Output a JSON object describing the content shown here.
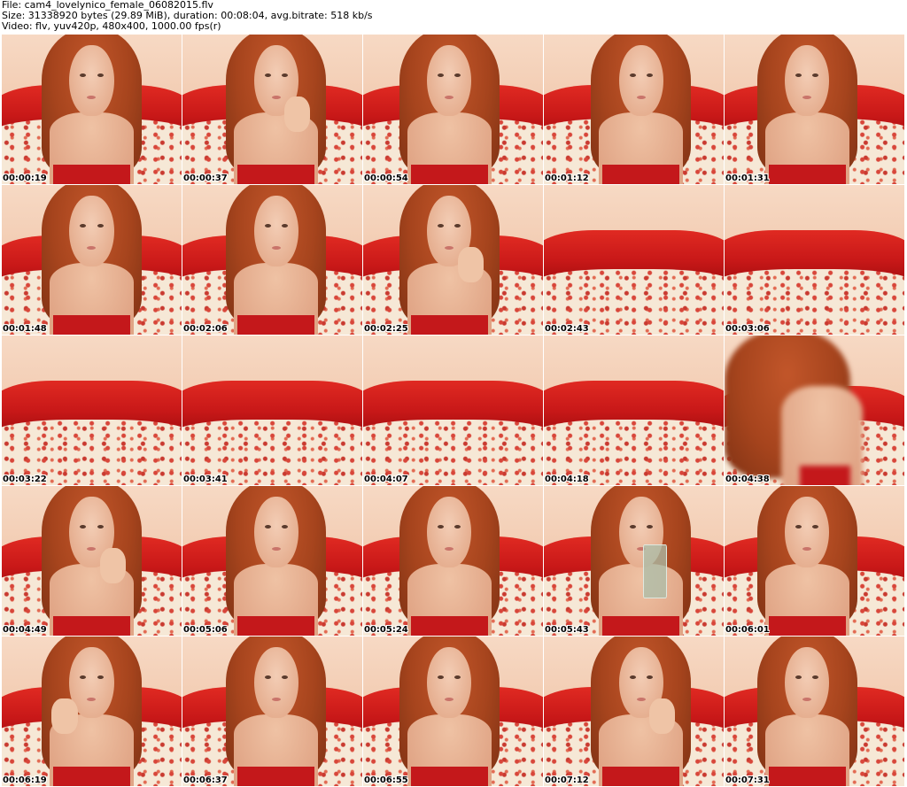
{
  "header": {
    "file_line": "File: cam4_lovelynico_female_06082015.flv",
    "size_line": "Size: 31338920 bytes (29.89 MiB), duration: 00:08:04, avg.bitrate: 518 kb/s",
    "video_line": "Video: flv, yuv420p, 480x400, 1000.00 fps(r)"
  },
  "frames": [
    {
      "timestamp": "00:00:19",
      "scene": "person"
    },
    {
      "timestamp": "00:00:37",
      "scene": "person-hand"
    },
    {
      "timestamp": "00:00:54",
      "scene": "person"
    },
    {
      "timestamp": "00:01:12",
      "scene": "person"
    },
    {
      "timestamp": "00:01:31",
      "scene": "person"
    },
    {
      "timestamp": "00:01:48",
      "scene": "person"
    },
    {
      "timestamp": "00:02:06",
      "scene": "person"
    },
    {
      "timestamp": "00:02:25",
      "scene": "person-hand"
    },
    {
      "timestamp": "00:02:43",
      "scene": "empty"
    },
    {
      "timestamp": "00:03:06",
      "scene": "empty"
    },
    {
      "timestamp": "00:03:22",
      "scene": "empty"
    },
    {
      "timestamp": "00:03:41",
      "scene": "empty"
    },
    {
      "timestamp": "00:04:07",
      "scene": "empty"
    },
    {
      "timestamp": "00:04:18",
      "scene": "empty"
    },
    {
      "timestamp": "00:04:38",
      "scene": "blur"
    },
    {
      "timestamp": "00:04:49",
      "scene": "person-hand"
    },
    {
      "timestamp": "00:05:06",
      "scene": "person"
    },
    {
      "timestamp": "00:05:24",
      "scene": "person"
    },
    {
      "timestamp": "00:05:43",
      "scene": "person-glass"
    },
    {
      "timestamp": "00:06:01",
      "scene": "person"
    },
    {
      "timestamp": "00:06:19",
      "scene": "person-hand"
    },
    {
      "timestamp": "00:06:37",
      "scene": "person"
    },
    {
      "timestamp": "00:06:55",
      "scene": "person"
    },
    {
      "timestamp": "00:07:12",
      "scene": "person-hand"
    },
    {
      "timestamp": "00:07:31",
      "scene": "person"
    }
  ]
}
